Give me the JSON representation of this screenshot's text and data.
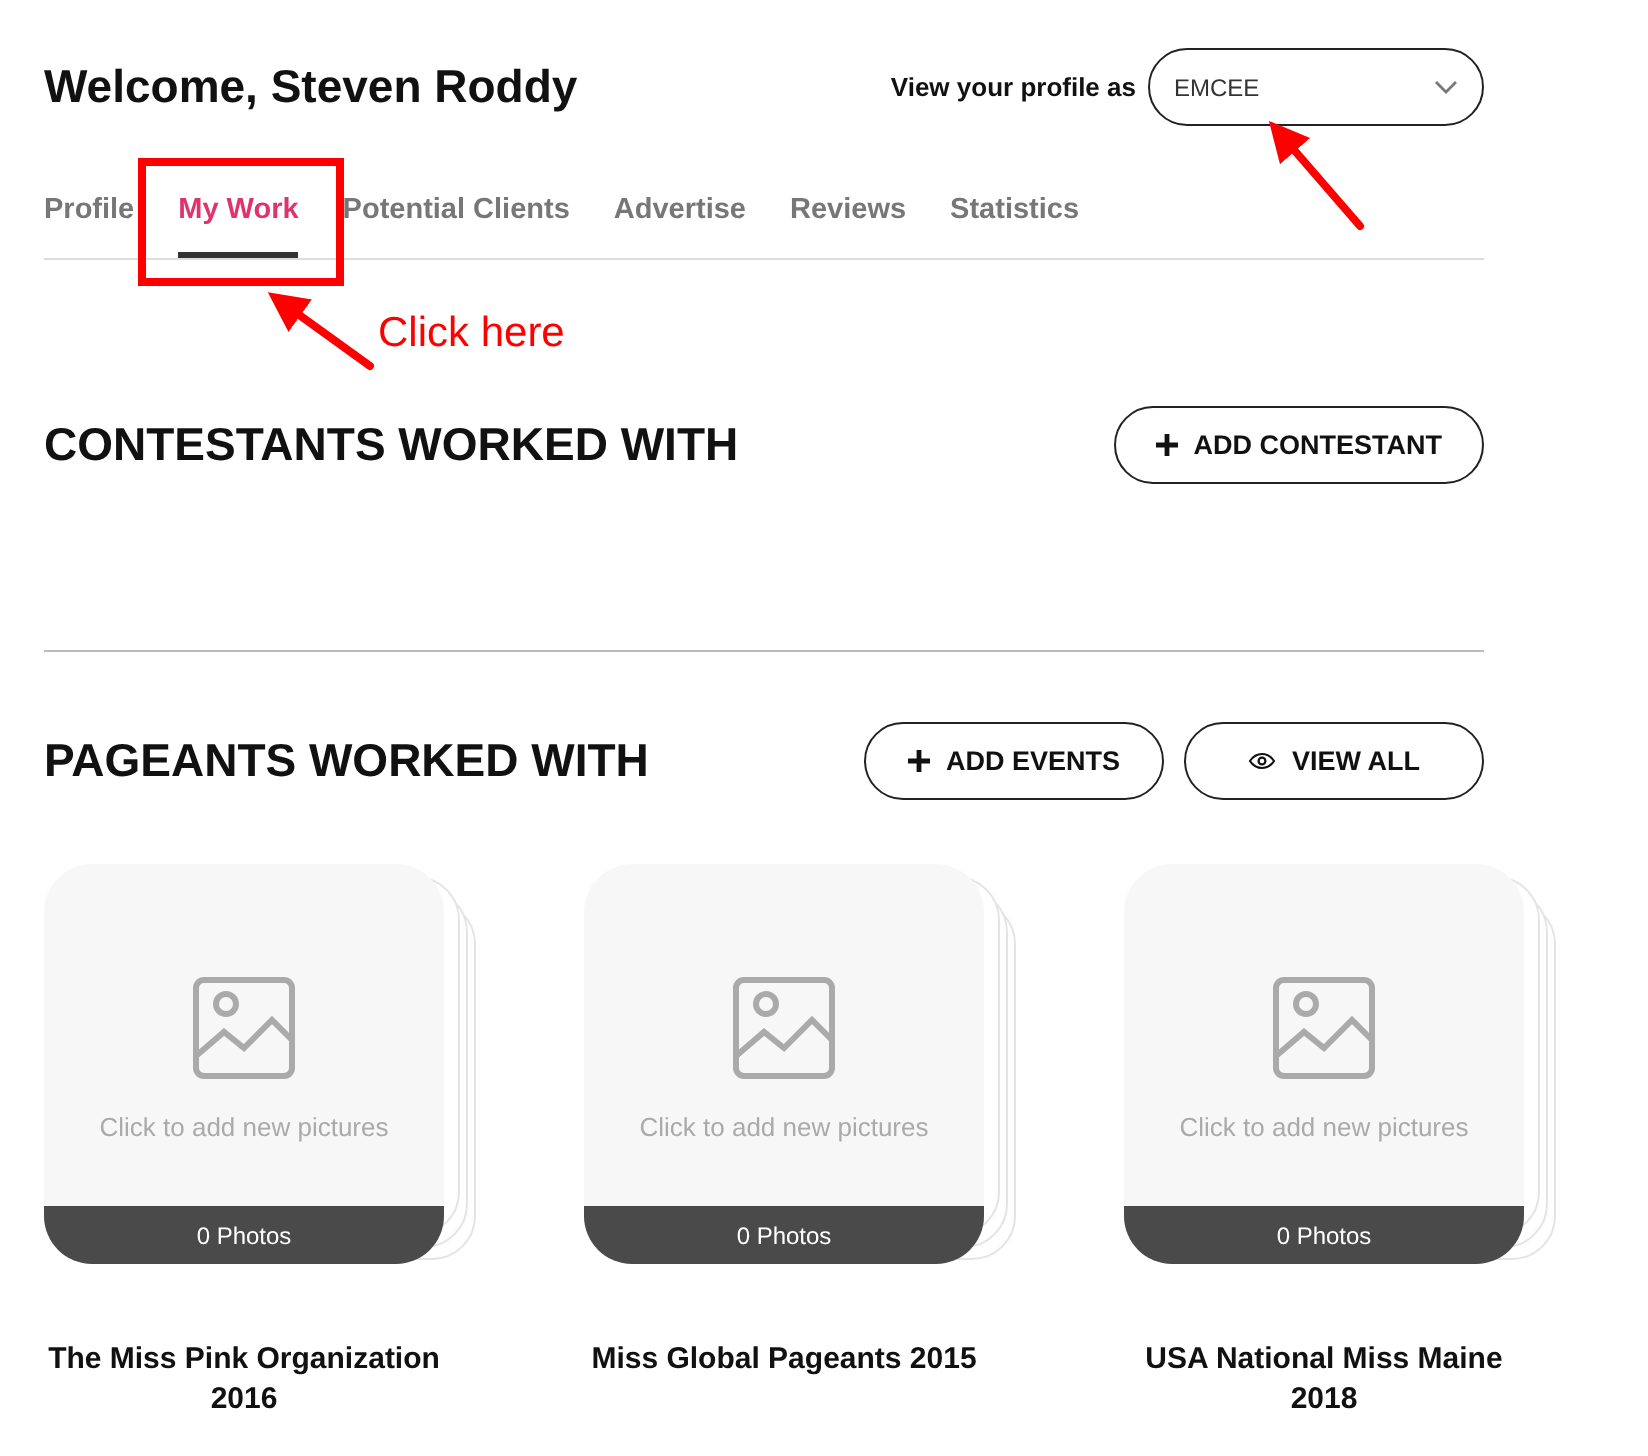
{
  "header": {
    "title": "Welcome, Steven Roddy",
    "view_as_label": "View your profile as",
    "view_as_value": "EMCEE"
  },
  "tabs": [
    {
      "label": "Profile",
      "selected": false
    },
    {
      "label": "My Work",
      "selected": true
    },
    {
      "label": "Potential Clients",
      "selected": false
    },
    {
      "label": "Advertise",
      "selected": false
    },
    {
      "label": "Reviews",
      "selected": false
    },
    {
      "label": "Statistics",
      "selected": false
    }
  ],
  "annotation": {
    "text": "Click here"
  },
  "contestants": {
    "title": "CONTESTANTS WORKED WITH",
    "button": "ADD CONTESTANT"
  },
  "pageants": {
    "title": "PAGEANTS WORKED WITH",
    "buttons": [
      {
        "kind": "add",
        "label": "ADD EVENTS"
      },
      {
        "kind": "view",
        "label": "VIEW ALL"
      }
    ],
    "items": [
      {
        "hint": "Click to add new pictures",
        "count": "0 Photos",
        "name": "The Miss Pink Organization 2016"
      },
      {
        "hint": "Click to add new pictures",
        "count": "0 Photos",
        "name": "Miss Global Pageants 2015"
      },
      {
        "hint": "Click to add new pictures",
        "count": "0 Photos",
        "name": "USA National Miss Maine 2018"
      }
    ]
  }
}
